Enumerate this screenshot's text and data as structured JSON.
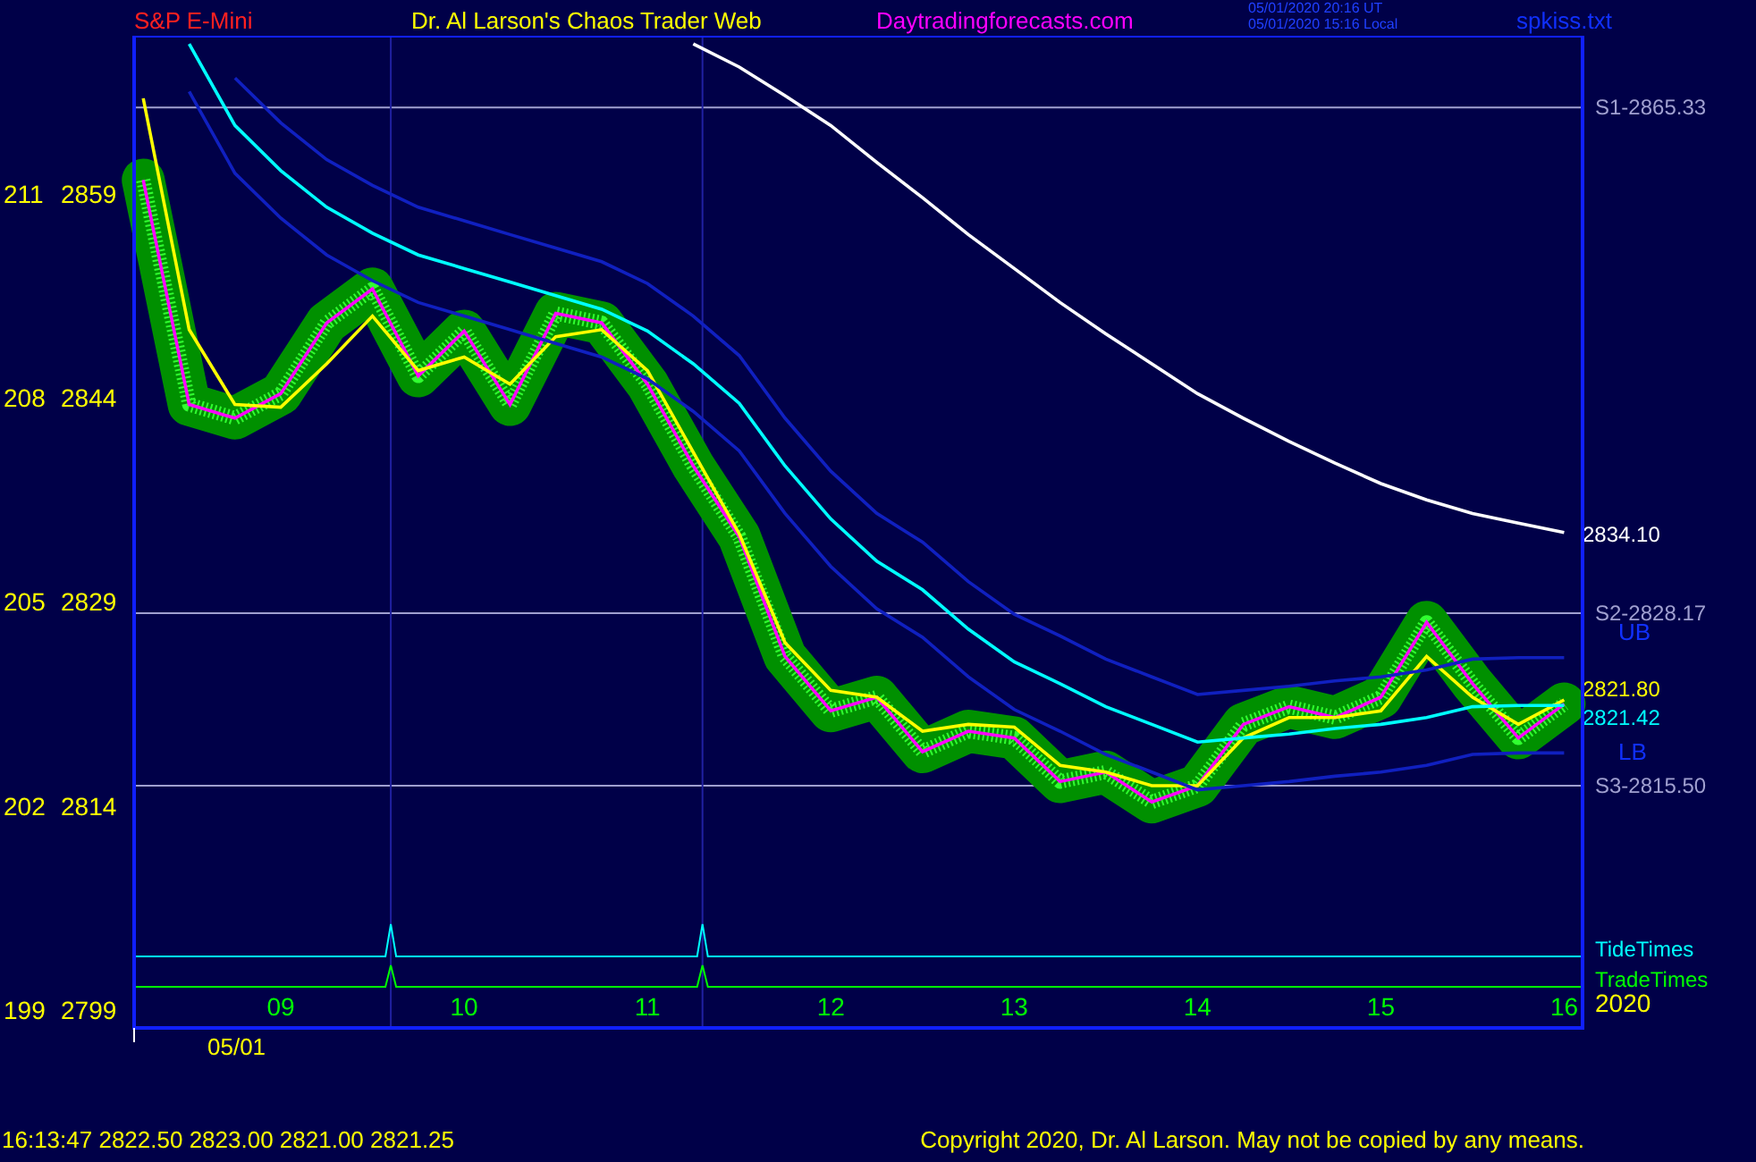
{
  "header": {
    "symbol": "S&P E-Mini",
    "title": "Dr. Al Larson's Chaos Trader Web",
    "site": "Daytradingforecasts.com",
    "time_ut": "05/01/2020 20:16 UT",
    "time_local": "05/01/2020 15:16 Local",
    "file": "spkiss.txt"
  },
  "chart": {
    "chart_data": {
      "type": "line",
      "xlim": [
        8.2,
        16.1
      ],
      "ylim": [
        2797.7,
        2870.6
      ],
      "x": [
        8.25,
        8.5,
        8.75,
        9,
        9.25,
        9.5,
        9.75,
        10,
        10.25,
        10.5,
        10.75,
        11,
        11.25,
        11.5,
        11.75,
        12,
        12.25,
        12.5,
        12.75,
        13,
        13.25,
        13.5,
        13.75,
        14,
        14.25,
        14.5,
        14.75,
        15,
        15.25,
        15.5,
        15.75,
        16
      ],
      "xticks": [
        {
          "value": 9,
          "label": "09"
        },
        {
          "value": 10,
          "label": "10"
        },
        {
          "value": 11,
          "label": "11"
        },
        {
          "value": 12,
          "label": "12"
        },
        {
          "value": 13,
          "label": "13"
        },
        {
          "value": 14,
          "label": "14"
        },
        {
          "value": 15,
          "label": "15"
        },
        {
          "value": 16,
          "label": "16"
        }
      ],
      "yticks": [
        2859,
        2844,
        2829,
        2814,
        2799
      ],
      "series": [
        {
          "color": "#ff00ff",
          "values": [
            2860,
            2843.5,
            2842.5,
            2844.3,
            2849.5,
            2852,
            2845.6,
            2848.9,
            2843.5,
            2850.2,
            2849.5,
            2845,
            2839,
            2833.8,
            2825,
            2821,
            2822,
            2818,
            2819.5,
            2819,
            2815.8,
            2816.5,
            2814.3,
            2815.5,
            2820,
            2821.3,
            2820.5,
            2822,
            2827.5,
            2823,
            2819,
            2821.5
          ]
        },
        {
          "color": "#ffff00",
          "values": [
            2866,
            2849,
            2843.5,
            2843.3,
            2846.5,
            2850,
            2846,
            2847,
            2845,
            2848.5,
            2849,
            2846,
            2840,
            2834,
            2826,
            2822.5,
            2822,
            2819.5,
            2820,
            2819.8,
            2817,
            2816.5,
            2815.5,
            2815.5,
            2819,
            2820.5,
            2820.5,
            2821,
            2825,
            2822,
            2820,
            2821.8
          ]
        },
        {
          "color": "#00ffff",
          "values": [
            null,
            2870,
            2864,
            2860.7,
            2858,
            2856.1,
            2854.5,
            2853.5,
            2852.5,
            2851.5,
            2850.5,
            2848.9,
            2846.5,
            2843.6,
            2839,
            2835.1,
            2832,
            2829.9,
            2827,
            2824.6,
            2823,
            2821.3,
            2820,
            2818.7,
            2819,
            2819.3,
            2819.7,
            2820,
            2820.5,
            2821.3,
            2821.4,
            2821.4
          ]
        },
        {
          "color": "#ffffff",
          "values": [
            null,
            null,
            null,
            null,
            null,
            null,
            null,
            null,
            null,
            null,
            null,
            null,
            2870,
            2868.3,
            2866.2,
            2864,
            2861.3,
            2858.7,
            2856,
            2853.5,
            2851,
            2848.7,
            2846.5,
            2844.3,
            2842.5,
            2840.8,
            2839.2,
            2837.7,
            2836.5,
            2835.5,
            2834.8,
            2834.1
          ]
        },
        {
          "color": "#1020c0",
          "values": [
            null,
            null,
            2867.5,
            2864.2,
            2861.5,
            2859.6,
            2858,
            2857,
            2856,
            2855,
            2854,
            2852.4,
            2850,
            2847.1,
            2842.5,
            2838.6,
            2835.5,
            2833.4,
            2830.5,
            2828.1,
            2826.5,
            2824.8,
            2823.5,
            2822.2,
            2822.5,
            2822.8,
            2823.2,
            2823.5,
            2824,
            2824.8,
            2824.9,
            2824.9
          ]
        },
        {
          "color": "#1020c0",
          "values": [
            null,
            2866.5,
            2860.5,
            2857.2,
            2854.5,
            2852.6,
            2851,
            2850,
            2849,
            2848,
            2847,
            2845.4,
            2843,
            2840.1,
            2835.5,
            2831.6,
            2828.5,
            2826.4,
            2823.5,
            2821.1,
            2819.5,
            2817.8,
            2816.5,
            2815.2,
            2815.5,
            2815.8,
            2816.2,
            2816.5,
            2817,
            2817.8,
            2817.9,
            2817.9
          ]
        }
      ],
      "ref_lines": [
        {
          "axis": "y",
          "value": 2865.33,
          "label": "S1-2865.33"
        },
        {
          "axis": "y",
          "value": 2828.17,
          "label": "S2-2828.17"
        },
        {
          "axis": "y",
          "value": 2815.5,
          "label": "S3-2815.50"
        },
        {
          "axis": "x",
          "value": 9.6
        },
        {
          "axis": "x",
          "value": 11.3
        }
      ]
    },
    "secondary_axis": [
      "211",
      "208",
      "205",
      "202",
      "199"
    ],
    "last_values": [
      {
        "label": "2834.10",
        "color": "#ffffff"
      },
      {
        "label": "2821.80",
        "color": "#ffff00"
      },
      {
        "label": "2821.42",
        "color": "#00ffff"
      }
    ],
    "band_labels": [
      "UB",
      "LB"
    ],
    "timing_lines": [
      {
        "label": "TideTimes",
        "color": "#00ffff"
      },
      {
        "label": "TradeTimes",
        "color": "#00ff00"
      }
    ],
    "date": "05/01",
    "year": "2020"
  },
  "footer": {
    "quote": "16:13:47  2822.50 2823.00 2821.00 2821.25",
    "copyright": "Copyright 2020, Dr. Al Larson. May not be copied by any means."
  }
}
